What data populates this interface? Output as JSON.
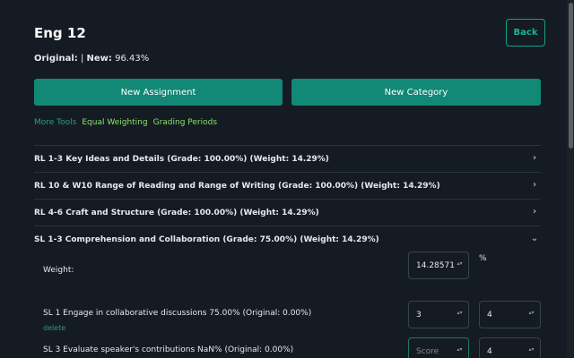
{
  "header": {
    "title": "Eng 12",
    "back_label": "Back",
    "original_label": "Original:",
    "separator": "|",
    "new_label": "New:",
    "new_value": "96.43%"
  },
  "actions": {
    "new_assignment": "New Assignment",
    "new_category": "New Category"
  },
  "tools": {
    "more_tools": "More Tools",
    "equal_weighting": "Equal Weighting",
    "grading_periods": "Grading Periods"
  },
  "categories": [
    {
      "label": "RL 1-3 Key Ideas and Details (Grade: 100.00%) (Weight: 14.29%)",
      "expanded": false
    },
    {
      "label": "RL 10 & W10 Range of Reading and Range of Writing (Grade: 100.00%) (Weight: 14.29%)",
      "expanded": false
    },
    {
      "label": "RL 4-6 Craft and Structure (Grade: 100.00%) (Weight: 14.29%)",
      "expanded": false
    },
    {
      "label": "SL 1-3 Comprehension and Collaboration (Grade: 75.00%) (Weight: 14.29%)",
      "expanded": true
    }
  ],
  "expanded_category": {
    "weight_label": "Weight:",
    "weight_value": "14.28571",
    "percent_sign": "%",
    "assignments": [
      {
        "label": "SL 1 Engage in collaborative discussions 75.00% (Original: 0.00%)",
        "score": "3",
        "score_placeholder": "",
        "total": "4",
        "delete_label": "delete"
      },
      {
        "label": "SL 3 Evaluate speaker's contributions NaN% (Original: 0.00%)",
        "score": "",
        "score_placeholder": "Score",
        "total": "4"
      }
    ]
  },
  "icons": {
    "chevron_right": "›",
    "chevron_down": "⌄",
    "spinner": "▴▾"
  }
}
